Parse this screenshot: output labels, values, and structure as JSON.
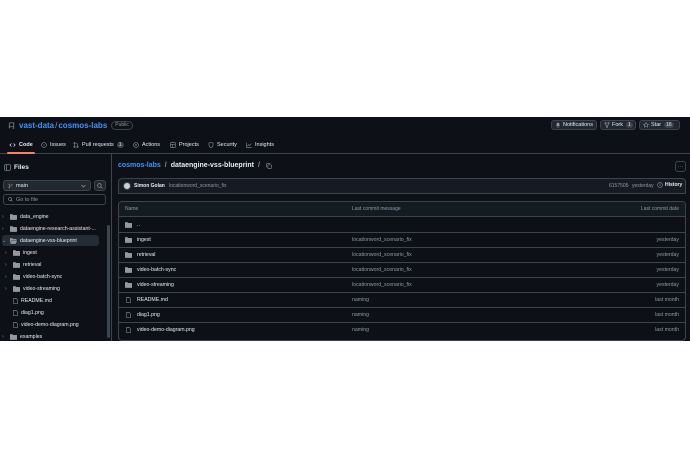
{
  "repo": {
    "owner": "vast-data",
    "name": "cosmos-labs",
    "visibility": "Public",
    "notifications_label": "Notifications",
    "fork_label": "Fork",
    "fork_count": "1",
    "star_label": "Star",
    "star_count": "16"
  },
  "tabs": [
    {
      "label": "Code",
      "icon": "code-icon"
    },
    {
      "label": "Issues",
      "icon": "issue-icon"
    },
    {
      "label": "Pull requests",
      "icon": "pull-request-icon",
      "count": "1"
    },
    {
      "label": "Actions",
      "icon": "play-icon"
    },
    {
      "label": "Projects",
      "icon": "table-icon"
    },
    {
      "label": "Security",
      "icon": "shield-icon"
    },
    {
      "label": "Insights",
      "icon": "graph-icon"
    }
  ],
  "sidebar": {
    "title": "Files",
    "branch": "main",
    "goto_placeholder": "Go to file",
    "tree": [
      {
        "label": "data_engine",
        "type": "folder"
      },
      {
        "label": "dataengine-research-assistant-...",
        "type": "folder"
      },
      {
        "label": "dataengine-vss-blueprint",
        "type": "folder-open"
      },
      {
        "label": "ingest",
        "type": "folder"
      },
      {
        "label": "retrieval",
        "type": "folder"
      },
      {
        "label": "video-batch-sync",
        "type": "folder"
      },
      {
        "label": "video-streaming",
        "type": "folder"
      },
      {
        "label": "README.md",
        "type": "file"
      },
      {
        "label": "diag1.png",
        "type": "file"
      },
      {
        "label": "video-demo-diagram.png",
        "type": "file"
      },
      {
        "label": "examples",
        "type": "folder"
      }
    ]
  },
  "breadcrumb": {
    "repo": "cosmos-labs",
    "sep": "/",
    "folder": "dataengine-vss-blueprint",
    "trail": "/"
  },
  "commit": {
    "author": "Simon Golan",
    "message": "locationword_scenario_fix",
    "hash": "6157505",
    "dot": "·",
    "time": "yesterday",
    "history_label": "History"
  },
  "table": {
    "headers": {
      "name": "Name",
      "message": "Last commit message",
      "date": "Last commit date"
    },
    "parent": "..",
    "rows": [
      {
        "name": "ingest",
        "type": "folder",
        "message": "locationword_scenario_fix",
        "date": "yesterday"
      },
      {
        "name": "retrieval",
        "type": "folder",
        "message": "locationword_scenario_fix",
        "date": "yesterday"
      },
      {
        "name": "video-batch-sync",
        "type": "folder",
        "message": "locationword_scenario_fix",
        "date": "yesterday"
      },
      {
        "name": "video-streaming",
        "type": "folder",
        "message": "locationword_scenario_fix",
        "date": "yesterday"
      },
      {
        "name": "README.md",
        "type": "file",
        "message": "naming",
        "date": "last month"
      },
      {
        "name": "diag1.png",
        "type": "file",
        "message": "naming",
        "date": "last month"
      },
      {
        "name": "video-demo-diagram.png",
        "type": "file",
        "message": "naming",
        "date": "last month"
      }
    ]
  },
  "colors": {
    "background": "#0d1117",
    "border": "#3d444d",
    "link": "#4493f8",
    "folder": "#9198a1",
    "tab_underline": "#f78166"
  }
}
